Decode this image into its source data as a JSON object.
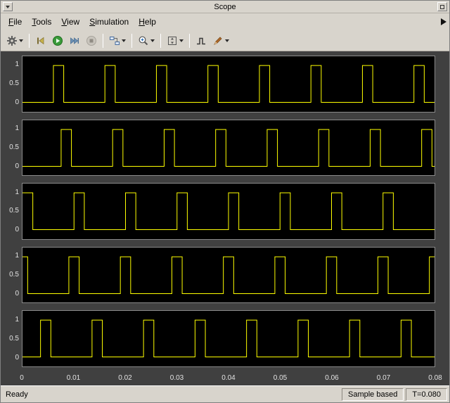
{
  "window": {
    "title": "Scope"
  },
  "menu": {
    "items": [
      {
        "label": "File"
      },
      {
        "label": "Tools"
      },
      {
        "label": "View"
      },
      {
        "label": "Simulation"
      },
      {
        "label": "Help"
      }
    ]
  },
  "toolbar": {
    "buttons": [
      {
        "name": "settings-button",
        "icon": "gear-icon",
        "dropdown": true
      },
      {
        "name": "step-back-button",
        "icon": "step-back-icon",
        "dropdown": false
      },
      {
        "name": "run-button",
        "icon": "run-icon",
        "dropdown": false
      },
      {
        "name": "step-forward-button",
        "icon": "step-forward-icon",
        "dropdown": false
      },
      {
        "name": "stop-button",
        "icon": "stop-icon",
        "dropdown": false
      },
      {
        "name": "signal-selector-button",
        "icon": "signal-selector-icon",
        "dropdown": true
      },
      {
        "name": "zoom-button",
        "icon": "zoom-in-icon",
        "dropdown": true
      },
      {
        "name": "fit-view-button",
        "icon": "fit-to-view-icon",
        "dropdown": true
      },
      {
        "name": "measurements-button",
        "icon": "staircase-signal-icon",
        "dropdown": false
      },
      {
        "name": "style-button",
        "icon": "brush-icon",
        "dropdown": true
      }
    ]
  },
  "statusbar": {
    "ready": "Ready",
    "sample_mode": "Sample based",
    "time": "T=0.080"
  },
  "chart_data": {
    "type": "line",
    "waveform": "pulse-train",
    "title": "",
    "xlabel": "",
    "ylabel": "",
    "background": "#000000",
    "trace_color": "#ffff00",
    "grid": false,
    "xlim": [
      0,
      0.08
    ],
    "ylim": [
      -0.25,
      1.25
    ],
    "xticks": [
      0,
      0.01,
      0.02,
      0.03,
      0.04,
      0.05,
      0.06,
      0.07,
      0.08
    ],
    "xtick_labels": [
      "0",
      "0.01",
      "0.02",
      "0.03",
      "0.04",
      "0.05",
      "0.06",
      "0.07",
      "0.08"
    ],
    "yticks": [
      0,
      0.5,
      1
    ],
    "ytick_labels": [
      "0",
      "0.5",
      "1"
    ],
    "period": 0.01,
    "pulse_width": 0.002,
    "low_value": 0,
    "high_value": 1,
    "traces": [
      {
        "name": "signal-1",
        "delay": 0.006
      },
      {
        "name": "signal-2",
        "delay": 0.0075
      },
      {
        "name": "signal-3",
        "delay": 0.0
      },
      {
        "name": "signal-4",
        "delay": 0.009
      },
      {
        "name": "signal-5",
        "delay": 0.0035
      }
    ]
  }
}
